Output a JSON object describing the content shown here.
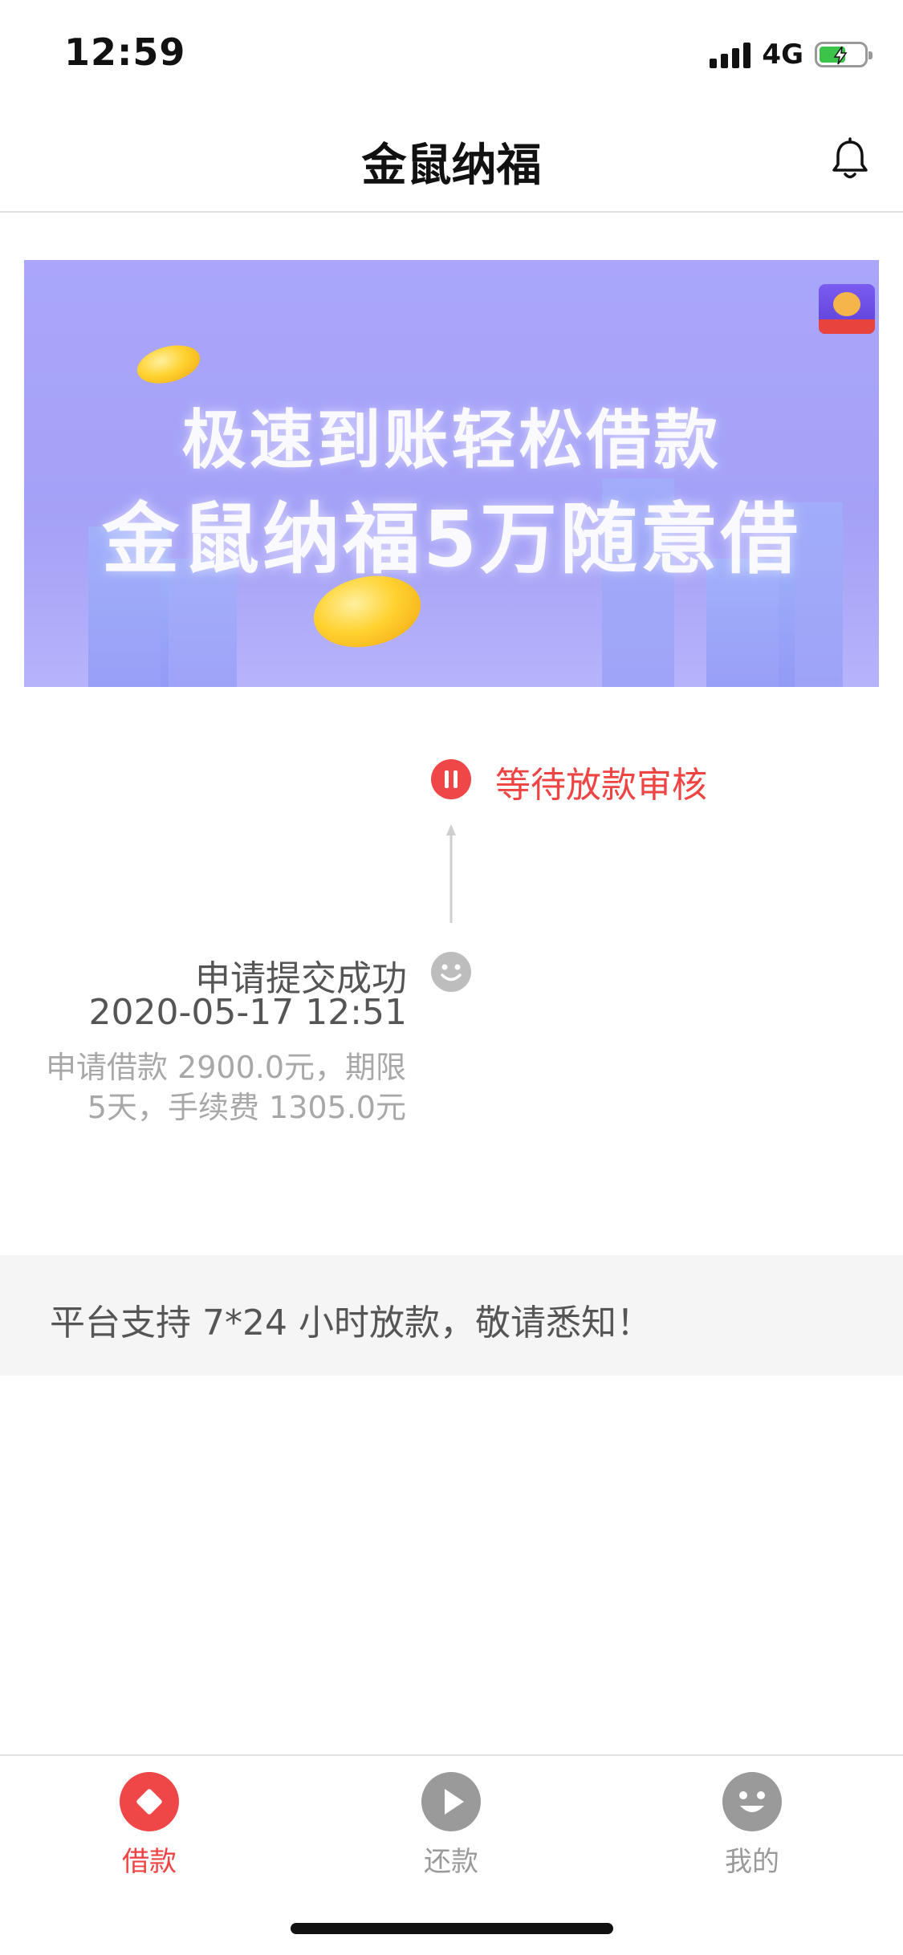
{
  "status_bar": {
    "time": "12:59",
    "network": "4G"
  },
  "nav": {
    "title": "金鼠纳福"
  },
  "banner": {
    "line1": "极速到账轻松借款",
    "line2": "金鼠纳福5万随意借"
  },
  "timeline": {
    "current_status": "等待放款审核",
    "step": {
      "title": "申请提交成功",
      "time": "2020-05-17 12:51",
      "detail": "申请借款 2900.0元，期限 5天，手续费 1305.0元"
    }
  },
  "notice": {
    "text": "平台支持 7*24 小时放款，敬请悉知！"
  },
  "tabs": [
    {
      "label": "借款",
      "icon": "diamond-icon",
      "active": true
    },
    {
      "label": "还款",
      "icon": "play-icon",
      "active": false
    },
    {
      "label": "我的",
      "icon": "smile-icon",
      "active": false
    }
  ],
  "colors": {
    "accent": "#ee4444",
    "inactive": "#9a9a9a",
    "banner_bg": "#a9a6fb"
  }
}
